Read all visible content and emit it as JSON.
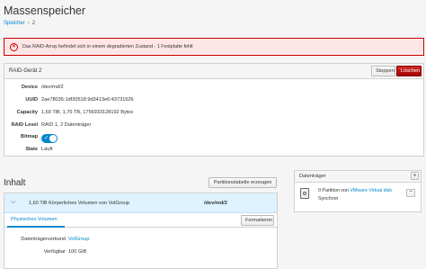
{
  "page": {
    "title": "Massenspeicher"
  },
  "breadcrumb": {
    "parent": "Speicher",
    "current": "2"
  },
  "alert": {
    "icon": "error-circle-icon",
    "text": "Das RAID-Array befindet sich in einem degradierten Zustand - 1 Festplatte fehlt"
  },
  "raid": {
    "header": "RAID-Gerät 2",
    "stop_label": "Stoppen",
    "delete_label": "Löschen",
    "fields": {
      "device": {
        "label": "Device",
        "value": "/dev/md/2"
      },
      "uuid": {
        "label": "UUID",
        "value": "2ae78035:1df30518:9d3413e6:43731626"
      },
      "capacity": {
        "label": "Capacity",
        "value": "1,60 TiB, 1,76 TB, 1756933128192 Bytes"
      },
      "raid_level": {
        "label": "RAID Level",
        "value": "RAID 1, 2 Datenträger"
      },
      "bitmap": {
        "label": "Bitmap",
        "enabled": true
      },
      "state": {
        "label": "State",
        "value": "Läuft"
      }
    }
  },
  "content": {
    "title": "Inhalt",
    "create_partition_table_label": "Partitionstabelle erzeugen",
    "volume": {
      "description": "1,60 TiB Körperliches Volumen von VolGroup",
      "device": "/dev/md/2"
    },
    "tab_label": "Physisches Volumen",
    "format_label": "Formatieren",
    "group_label": "Datenträgerverbund",
    "group_value": "VolGroup",
    "free_label": "Verfügbar",
    "free_value": "100 GiB"
  },
  "drives": {
    "header": "Datenträger",
    "add_label": "+",
    "remove_label": "−",
    "item": {
      "line1_prefix": "0 Partition von ",
      "line1_link": "VMware Virtual disk",
      "line2": "Synchron"
    }
  },
  "colors": {
    "accent": "#0088ce",
    "danger": "#cc0000",
    "alert_bg": "#ffe6e6"
  }
}
